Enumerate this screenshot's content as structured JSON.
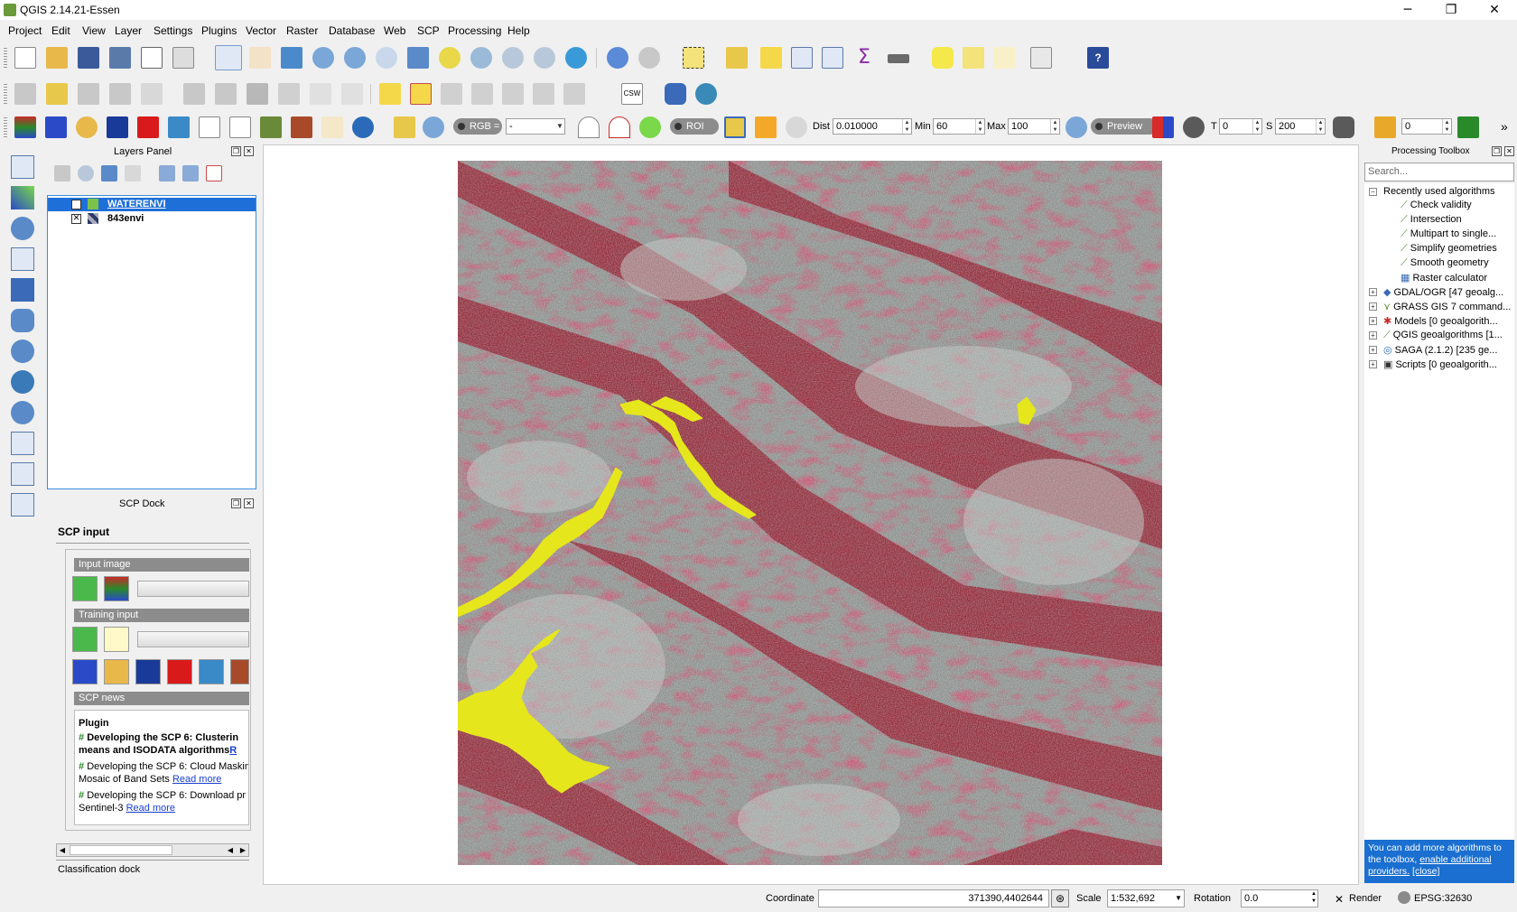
{
  "window": {
    "title": "QGIS 2.14.21-Essen",
    "controls": [
      "─",
      "❐",
      "✕"
    ]
  },
  "menu": [
    "Project",
    "Edit",
    "View",
    "Layer",
    "Settings",
    "Plugins",
    "Vector",
    "Raster",
    "Database",
    "Web",
    "SCP",
    "Processing",
    "Help"
  ],
  "scp_toolbar": {
    "rgb_label": "RGB =",
    "rgb_value": "-",
    "roi_label": "ROI",
    "dist_label": "Dist",
    "dist_value": "0.010000",
    "min_label": "Min",
    "min_value": "60",
    "max_label": "Max",
    "max_value": "100",
    "preview_label": "Preview",
    "t_label": "T",
    "t_value": "0",
    "s_label": "S",
    "s_value": "200",
    "extra_value": "0",
    "more": "»"
  },
  "layers_panel": {
    "title": "Layers Panel",
    "layers": [
      {
        "name": "WATERENVI",
        "checked": "✕",
        "selected": true,
        "swatch": "#7cc24a"
      },
      {
        "name": "843envi",
        "checked": "✕",
        "selected": false,
        "swatch": "#4a5a8a"
      }
    ]
  },
  "scp_dock": {
    "title": "SCP Dock",
    "tab": "SCP input",
    "input_image_label": "Input image",
    "training_input_label": "Training input",
    "news_label": "SCP news",
    "news": {
      "heading": "Plugin",
      "item1_bold_a": "Developing the SCP 6: Clusterin",
      "item1_bold_b": "means and ISODATA algorithms",
      "item1_link": "R",
      "item2_a": "Developing the SCP 6: Cloud Maskin",
      "item2_b": "Mosaic of Band Sets",
      "item2_link": "Read more",
      "item3_a": "Developing the SCP 6: Download pr",
      "item3_b": "Sentinel-3",
      "item3_link": "Read more"
    },
    "classification_tab": "Classification dock"
  },
  "processing_toolbox": {
    "title": "Processing Toolbox",
    "search_placeholder": "Search...",
    "recent_group": "Recently used algorithms",
    "recent": [
      "Check validity",
      "Intersection",
      "Multipart to single...",
      "Simplify geometries",
      "Smooth geometry",
      "Raster calculator"
    ],
    "providers": [
      "GDAL/OGR [47 geoalg...",
      "GRASS GIS 7 command...",
      "Models [0 geoalgorith...",
      "QGIS geoalgorithms [1...",
      "SAGA (2.1.2) [235 ge...",
      "Scripts [0 geoalgorith..."
    ],
    "info_text": "You can add more algorithms to the toolbox,",
    "info_link": "enable additional providers.",
    "info_close": "[close]"
  },
  "statusbar": {
    "coordinate_label": "Coordinate",
    "coordinate_value": "371390,4402644",
    "scale_label": "Scale",
    "scale_value": "1:532,692",
    "rotation_label": "Rotation",
    "rotation_value": "0.0",
    "render_check": "✕",
    "render_label": "Render",
    "crs": "EPSG:32630"
  },
  "colors": {
    "selection": "#1e6fd8",
    "water_layer": "#e8e81a",
    "vegetation_red": "#9a1c2c",
    "info_blue": "#1a6fd0"
  }
}
